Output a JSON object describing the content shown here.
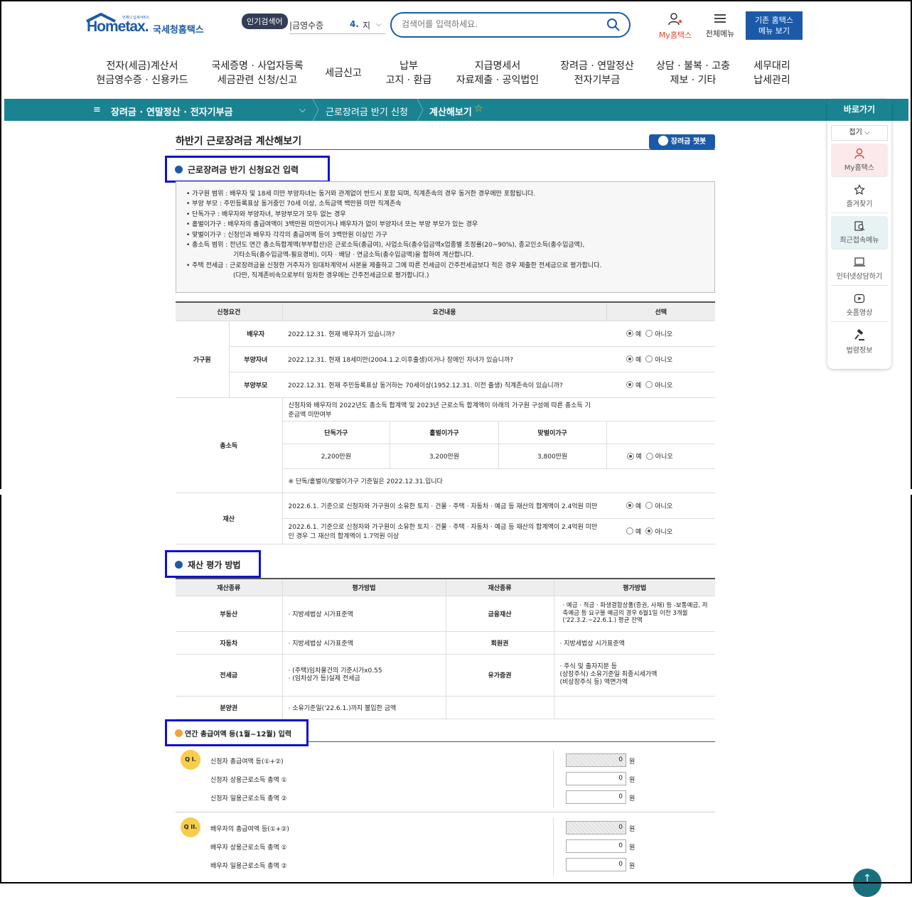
{
  "header": {
    "logo_brand": "Hometax.",
    "logo_sub": "국세청홈택스",
    "logo_tiny": "언제나 납세서비스",
    "popular_badge": "인기검색어",
    "popular_item": "|금영수증",
    "popular_rank": "4.",
    "popular_rank_text": "지",
    "search_placeholder": "검색어를 입력하세요.",
    "my_hometax": "My홈택스",
    "all_menu": "전체메뉴",
    "old_menu_line1": "기존 홈택스",
    "old_menu_line2": "메뉴 보기"
  },
  "gnb": [
    {
      "l1": "전자(세금)계산서",
      "l2": "현금영수증 · 신용카드"
    },
    {
      "l1": "국세증명 · 사업자등록",
      "l2": "세금관련 신청/신고"
    },
    {
      "l1": "세금신고",
      "l2": ""
    },
    {
      "l1": "납부",
      "l2": "고지 · 환급"
    },
    {
      "l1": "지급명세서",
      "l2": "자료제출 · 공익법인"
    },
    {
      "l1": "장려금 · 연말정산",
      "l2": "전자기부금"
    },
    {
      "l1": "상담 · 불복 · 고충",
      "l2": "제보 · 기타"
    },
    {
      "l1": "세무대리",
      "l2": "납세관리"
    }
  ],
  "breadcrumb": {
    "menu_icon": "≡",
    "level1": "장려금 · 연말정산 · 전자기부금",
    "level2": "근로장려금 반기 신청",
    "level3": "계산해보기"
  },
  "quick": {
    "title": "바로가기",
    "fold": "접기",
    "items": [
      "My홈택스",
      "즐겨찾기",
      "최근접속메뉴",
      "인터넷상담하기",
      "숏폼영상",
      "법령정보"
    ]
  },
  "page": {
    "title": "하반기 근로장려금 계산해보기",
    "chatbot": "장려금 챗봇"
  },
  "section1": {
    "title": "근로장려금 반기 신청요건 입력"
  },
  "info": [
    "• 가구원 범위 : 배우자 및 18세 미만 부양자녀는 동거와 관계없이 반드시 포함 되며, 직계존속의 경우 동거한 경우에만 포함됩니다.",
    "• 부양 부모 : 주민등록표상 동거중인 70세 이상, 소득금액 백만원 미만 직계존속",
    "• 단독가구 : 배우자와 부양자녀, 부양부모가 모두 없는 경우",
    "• 홑벌이가구 : 배우자의 총급여액이 3백만원 미만이거나 배우자가 없이 부양자녀 또는 부양 부모가 있는 경우",
    "• 맞벌이가구 : 신청인과 배우자 각각의 총급여액 등이 3백만원 이상인 가구",
    "• 총소득 범위 : 전년도 연간 총소득합계액(부부합산)은 근로소득(총급여), 사업소득(총수입금액x업종별 조정률(20~90%), 종교인소득(총수입금액),",
    "기타소득(총수입금액-필요경비), 이자 · 배당 · 연금소득(총수입금액)을 합하여 계산합니다.",
    "• 주택 전세금 : 근로장려금을 신청한 거주자가 임대차계약서 사본을 제출하고 그에 따른 전세금이 간주전세금보다 적은 경우 제출한 전세금으로 평가합니다.",
    "(다만, 직계존비속으로부터 임차한 경우에는 간주전세금으로 평가합니다.)"
  ],
  "req_table": {
    "headers": [
      "신청요건",
      "요건내용",
      "선택"
    ],
    "yes": "예",
    "no": "아니오",
    "household_label": "가구원",
    "rows": [
      {
        "sub": "배우자",
        "text": "2022.12.31. 현재 배우자가 있습니까?"
      },
      {
        "sub": "부양자녀",
        "text": "2022.12.31. 현재 18세미만(2004.1.2.이후출생)이거나 장애인 자녀가 있습니까?"
      },
      {
        "sub": "부양부모",
        "text": "2022.12.31. 현재 주민등록표상 동거하는 70세이상(1952.12.31. 이전 출생) 직계존속이 있습니까?"
      }
    ],
    "income_label": "총소득",
    "income_text": "신청자와 배우자의 2022년도 총소득 합계액 및 2023년 근로소득 합계액이 아래의 가구원 구성에 따른 총소득 기준금액 미만여부",
    "income_cols": [
      "단독가구",
      "홑벌이가구",
      "맞벌이가구"
    ],
    "income_vals": [
      "2,200만원",
      "3,200만원",
      "3,800만원"
    ],
    "income_note": "※ 단독/홑벌이/맞벌이가구 기준일은 2022.12.31.입니다",
    "asset_label": "재산",
    "asset_rows": [
      "2022.6.1. 기준으로 신청자와 가구원이 소유한 토지 · 건물 · 주택 · 자동차 · 예금 등 재산의 합계액이 2.4억원 미만",
      "2022.6.1. 기준으로 신청자와 가구원이 소유한 토지 · 건물 · 주택 · 자동차 · 예금 등 재산의 합계액이 2.4억원 미만인 경우 그 재산의 합계액이 1.7억원 이상"
    ]
  },
  "section2": {
    "title": "재산 평가 방법"
  },
  "eval_table": {
    "headers": [
      "재산종류",
      "평가방법",
      "재산종류",
      "평가방법"
    ],
    "rows": [
      {
        "k1": "부동산",
        "v1": "· 지방세법상 시가표준액",
        "k2": "금융재산",
        "v2": "· 예금 · 적금 · 파생결합상품(증권, 사채) 등 -보통예금, 저축예금 등 요구불 예금의 경우 6월1일 이전 3개월('22.3.2.~22.6.1.) 평균 잔액"
      },
      {
        "k1": "자동차",
        "v1": "· 지방세법상 시가표준액",
        "k2": "회원권",
        "v2": "· 지방세법상 시가표준액"
      },
      {
        "k1": "전세금",
        "v1": "· (주택)임차물건의 기준시가x0.55",
        "v1b": "· (임차상가 등)실제 전세금",
        "k2": "유가증권",
        "v2": "· 주식 및 출자지분 등",
        "v2b": "(상장주식) 소유기준일 최종시세가액",
        "v2c": "(비상장주식 등) 액면가액"
      },
      {
        "k1": "분양권",
        "v1": "· 소유기준일('22.6.1.)까지 불입한 금액",
        "k2": "",
        "v2": ""
      }
    ]
  },
  "section3": {
    "title": "연간 총급여액 등(1월~12월) 입력"
  },
  "q1": {
    "badge": "Q I.",
    "rows": [
      "신청자 총급여액 등(①+②)",
      "신청자 상용근로소득 총액 ①",
      "신청자 일용근로소득 총액 ②"
    ],
    "values": [
      "0",
      "0",
      "0"
    ]
  },
  "q2": {
    "badge": "Q II.",
    "rows": [
      "배우자의 총급여액 등(①+②)",
      "배우자 상용근로소득 총액 ①",
      "배우자 일용근로소득 총액 ②"
    ],
    "values": [
      "0",
      "0",
      "0"
    ]
  },
  "unit_won": "원",
  "top_button": "↑"
}
